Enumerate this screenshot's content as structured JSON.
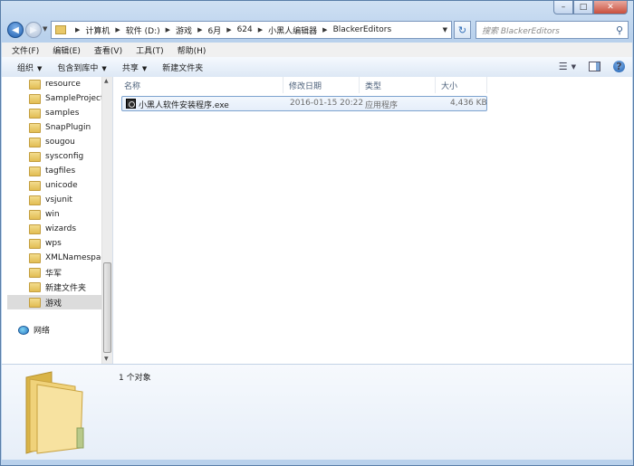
{
  "window": {
    "caption_buttons": {
      "minimize": "–",
      "maximize": "□",
      "close": "✕"
    }
  },
  "nav": {
    "back_icon": "back-arrow-icon",
    "forward_icon": "forward-arrow-icon"
  },
  "address_bar": {
    "breadcrumbs": [
      "计算机",
      "软件 (D:)",
      "游戏",
      "6月",
      "624",
      "小黑人编辑器",
      "BlackerEditors"
    ]
  },
  "search": {
    "placeholder": "搜索 BlackerEditors"
  },
  "menu": [
    "文件(F)",
    "编辑(E)",
    "查看(V)",
    "工具(T)",
    "帮助(H)"
  ],
  "toolbar": {
    "organize": "组织",
    "include_in_library": "包含到库中",
    "share": "共享",
    "new_folder": "新建文件夹"
  },
  "nav_pane": {
    "folders": [
      "resource",
      "SampleProjects",
      "samples",
      "SnapPlugin",
      "sougou",
      "sysconfig",
      "tagfiles",
      "unicode",
      "vsjunit",
      "win",
      "wizards",
      "wps",
      "XMLNamespac",
      "华军",
      "新建文件夹",
      "游戏"
    ],
    "selected": "游戏",
    "network": "网络"
  },
  "file_list": {
    "columns": [
      "名称",
      "修改日期",
      "类型",
      "大小"
    ],
    "files": [
      {
        "name": "小黑人软件安装程序.exe",
        "modified": "2016-01-15 20:22",
        "type": "应用程序",
        "size": "4,436 KB"
      }
    ]
  },
  "details": {
    "count": "1 个对象"
  },
  "colors": {
    "window_frame": "#b9d1ec",
    "selection_border": "#7da2ce",
    "folder_yellow": "#e2bd53"
  }
}
